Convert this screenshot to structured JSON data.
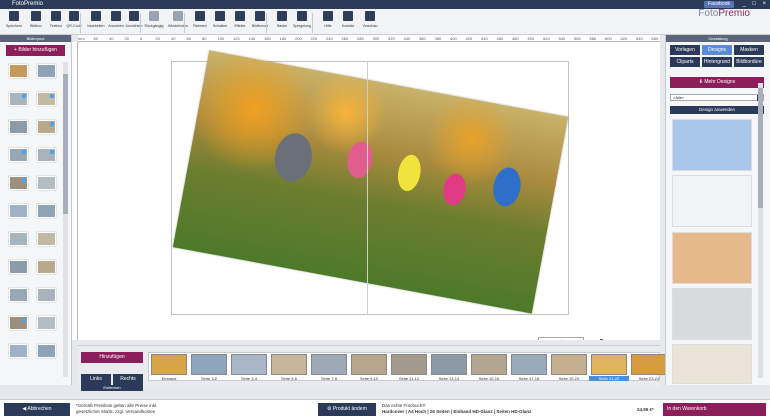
{
  "window": {
    "title": "FotoPremio",
    "facebook_label": "Facebook",
    "controls": [
      "_",
      "□",
      "×"
    ]
  },
  "toolbar": {
    "buttons": [
      {
        "label": "Speichern",
        "icon": "save-icon"
      },
      {
        "label": "Bildbox",
        "icon": "photos-icon"
      },
      {
        "label": "Textbox",
        "icon": "text-icon"
      },
      {
        "label": "QR-Code",
        "icon": "qrcode-icon"
      },
      {
        "label": "bearbeiten",
        "icon": "edit-icon"
      },
      {
        "label": "Anordnen",
        "icon": "arrange-icon"
      },
      {
        "label": "Ausrichten",
        "icon": "align-icon"
      },
      {
        "label": "Rückgängig",
        "icon": "undo-icon"
      },
      {
        "label": "Wiederholen",
        "icon": "redo-icon"
      },
      {
        "label": "Rahmen",
        "icon": "frame-icon"
      },
      {
        "label": "Schatten",
        "icon": "shadow-icon"
      },
      {
        "label": "Effekte",
        "icon": "effects-icon"
      },
      {
        "label": "Bildformat",
        "icon": "format-icon"
      },
      {
        "label": "Raster",
        "icon": "grid-icon"
      },
      {
        "label": "Spiegelung",
        "icon": "mirror-icon"
      },
      {
        "label": "Hilfe",
        "icon": "help-icon"
      },
      {
        "label": "Kontakt",
        "icon": "phone-icon"
      },
      {
        "label": "Vorschau",
        "icon": "preview-icon"
      }
    ]
  },
  "brand": {
    "name": "Foto",
    "name2": "Premio"
  },
  "left": {
    "header": "Bilderpool",
    "add_label": "Bilder hinzufügen"
  },
  "ruler": [
    "mm",
    "60",
    "40",
    "20",
    "0",
    "20",
    "40",
    "60",
    "80",
    "100",
    "120",
    "140",
    "160",
    "180",
    "200",
    "220",
    "240",
    "260",
    "280",
    "300",
    "320",
    "340",
    "360",
    "380",
    "400",
    "420",
    "440",
    "460",
    "480",
    "500",
    "520",
    "540",
    "560",
    "580",
    "600",
    "620",
    "640",
    "660"
  ],
  "zoom": {
    "value": "Ganze Seite"
  },
  "pages": {
    "add_label": "Hinzufügen",
    "links": "Links",
    "rechts": "Rechts",
    "entfernen": "Entfernen",
    "labels": [
      "Einband",
      "Seite 1-2",
      "Seite 3-4",
      "Seite 5-6",
      "Seite 7-8",
      "Seite 9-10",
      "Seite 11-12",
      "Seite 13-14",
      "Seite 15-16",
      "Seite 17-18",
      "Seite 19-20",
      "Seite 21-22",
      "Seite 23-24"
    ],
    "selected": 11
  },
  "right": {
    "header": "Gestaltung",
    "tabs": [
      "Vorlagen",
      "Designs",
      "Masken",
      "Cliparts",
      "Hintergrund",
      "Bildbordüre"
    ],
    "active_tab": 1,
    "more_label": "Mehr Designs",
    "filter": "<Alle>",
    "apply_label": "Design anwenden"
  },
  "bottom": {
    "back": "Abbrechen",
    "note": "*Gemäß Preisliste gelten alle Preise inkl. gesetzlicher MwSt. zzgl. Versandkosten",
    "product_btn": "Produkt ändern",
    "product_line1": "Das echte Fotobuch®",
    "product_line2": "Hardcover | A4 Hoch | 26 Seiten | Einband HD-Glanz | Seiten HD-Glanz",
    "price": "24,95 €*",
    "cart": "In den Warenkorb"
  },
  "colors": {
    "accent": "#8c1f5b",
    "navy": "#2c3a5a",
    "blue": "#5b8bd4"
  }
}
